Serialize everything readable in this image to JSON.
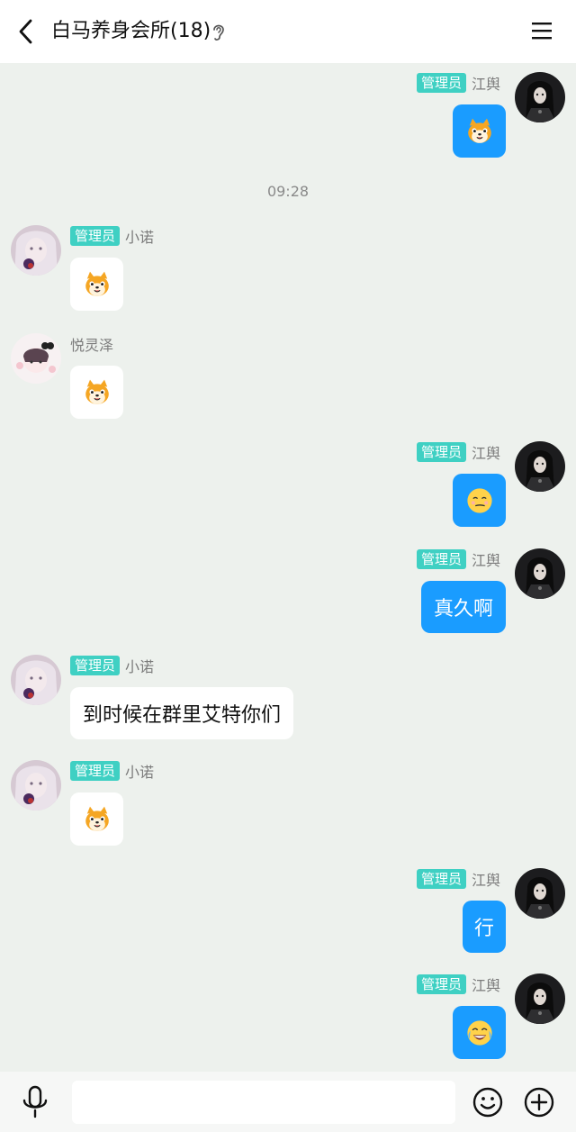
{
  "header": {
    "title": "白马养身会所(18)",
    "back_icon": "chevron-left-icon",
    "listen_icon": "ear-icon",
    "menu_icon": "menu-icon"
  },
  "timestamp": "09:28",
  "users": {
    "jiangyu": {
      "name": "江舆",
      "role": "管理员"
    },
    "xiaonuo": {
      "name": "小诺",
      "role": "管理员"
    },
    "yuelingze": {
      "name": "悦灵泽"
    }
  },
  "messages": [
    {
      "sender": "江舆",
      "badge": "管理员",
      "side": "right",
      "type": "sticker",
      "sticker": "shiba-dog-emoji"
    },
    {
      "sender": "小诺",
      "badge": "管理员",
      "side": "left",
      "type": "sticker",
      "sticker": "shiba-dog-emoji"
    },
    {
      "sender": "悦灵泽",
      "side": "left",
      "type": "sticker",
      "sticker": "shiba-dog-emoji"
    },
    {
      "sender": "江舆",
      "badge": "管理员",
      "side": "right",
      "type": "sticker",
      "sticker": "smirk-face-emoji"
    },
    {
      "sender": "江舆",
      "badge": "管理员",
      "side": "right",
      "type": "text",
      "text": "真久啊"
    },
    {
      "sender": "小诺",
      "badge": "管理员",
      "side": "left",
      "type": "text",
      "text": "到时候在群里艾特你们"
    },
    {
      "sender": "小诺",
      "badge": "管理员",
      "side": "left",
      "type": "sticker",
      "sticker": "shiba-dog-emoji"
    },
    {
      "sender": "江舆",
      "badge": "管理员",
      "side": "right",
      "type": "text",
      "text": "行"
    },
    {
      "sender": "江舆",
      "badge": "管理员",
      "side": "right",
      "type": "sticker",
      "sticker": "tears-of-joy-emoji"
    }
  ],
  "input_bar": {
    "voice_icon": "microphone-icon",
    "input_value": "",
    "emoji_icon": "smiley-icon",
    "more_icon": "plus-circle-icon"
  },
  "colors": {
    "background": "#edf1ed",
    "my_bubble": "#1a9cff",
    "other_bubble": "#ffffff",
    "admin_badge": "#3fd0c3"
  }
}
